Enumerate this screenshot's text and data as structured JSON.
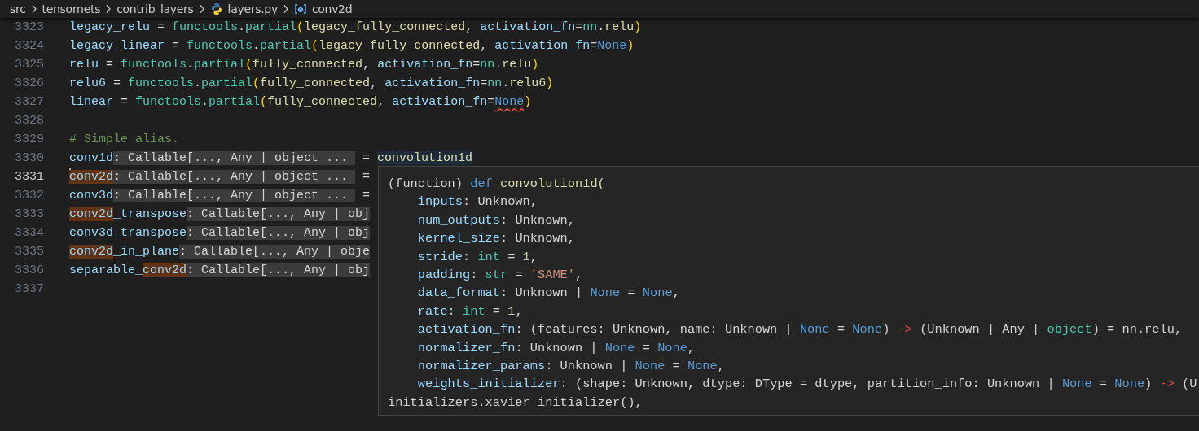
{
  "breadcrumb": [
    {
      "kind": "folder",
      "label": "src"
    },
    {
      "kind": "folder",
      "label": "tensornets"
    },
    {
      "kind": "folder",
      "label": "contrib_layers"
    },
    {
      "kind": "python-file",
      "label": "layers.py"
    },
    {
      "kind": "variable",
      "label": "conv2d"
    }
  ],
  "lines": [
    {
      "number": "3323",
      "current": false,
      "tokens": [
        {
          "kind": "var",
          "text": "legacy_relu"
        },
        {
          "kind": "plain",
          "text": " = "
        },
        {
          "kind": "module",
          "text": "functools"
        },
        {
          "kind": "plain",
          "text": "."
        },
        {
          "kind": "module",
          "text": "partial"
        },
        {
          "kind": "bracket",
          "text": "("
        },
        {
          "kind": "fn",
          "text": "legacy_fully_connected"
        },
        {
          "kind": "plain",
          "text": ", "
        },
        {
          "kind": "var",
          "text": "activation_fn"
        },
        {
          "kind": "plain",
          "text": "="
        },
        {
          "kind": "module",
          "text": "nn"
        },
        {
          "kind": "plain",
          "text": "."
        },
        {
          "kind": "fn",
          "text": "relu"
        },
        {
          "kind": "bracket",
          "text": ")"
        }
      ]
    },
    {
      "number": "3324",
      "current": false,
      "tokens": [
        {
          "kind": "var",
          "text": "legacy_linear"
        },
        {
          "kind": "plain",
          "text": " = "
        },
        {
          "kind": "module",
          "text": "functools"
        },
        {
          "kind": "plain",
          "text": "."
        },
        {
          "kind": "module",
          "text": "partial"
        },
        {
          "kind": "bracket",
          "text": "("
        },
        {
          "kind": "fn",
          "text": "legacy_fully_connected"
        },
        {
          "kind": "plain",
          "text": ", "
        },
        {
          "kind": "var",
          "text": "activation_fn"
        },
        {
          "kind": "plain",
          "text": "="
        },
        {
          "kind": "const",
          "text": "None"
        },
        {
          "kind": "bracket",
          "text": ")"
        }
      ]
    },
    {
      "number": "3325",
      "current": false,
      "tokens": [
        {
          "kind": "var",
          "text": "relu"
        },
        {
          "kind": "plain",
          "text": " = "
        },
        {
          "kind": "module",
          "text": "functools"
        },
        {
          "kind": "plain",
          "text": "."
        },
        {
          "kind": "module",
          "text": "partial"
        },
        {
          "kind": "bracket",
          "text": "("
        },
        {
          "kind": "fn",
          "text": "fully_connected"
        },
        {
          "kind": "plain",
          "text": ", "
        },
        {
          "kind": "var",
          "text": "activation_fn"
        },
        {
          "kind": "plain",
          "text": "="
        },
        {
          "kind": "module",
          "text": "nn"
        },
        {
          "kind": "plain",
          "text": "."
        },
        {
          "kind": "fn",
          "text": "relu"
        },
        {
          "kind": "bracket",
          "text": ")"
        }
      ]
    },
    {
      "number": "3326",
      "current": false,
      "tokens": [
        {
          "kind": "var",
          "text": "relu6"
        },
        {
          "kind": "plain",
          "text": " = "
        },
        {
          "kind": "module",
          "text": "functools"
        },
        {
          "kind": "plain",
          "text": "."
        },
        {
          "kind": "module",
          "text": "partial"
        },
        {
          "kind": "bracket",
          "text": "("
        },
        {
          "kind": "fn",
          "text": "fully_connected"
        },
        {
          "kind": "plain",
          "text": ", "
        },
        {
          "kind": "var",
          "text": "activation_fn"
        },
        {
          "kind": "plain",
          "text": "="
        },
        {
          "kind": "module",
          "text": "nn"
        },
        {
          "kind": "plain",
          "text": "."
        },
        {
          "kind": "fn",
          "text": "relu6"
        },
        {
          "kind": "bracket",
          "text": ")"
        }
      ]
    },
    {
      "number": "3327",
      "current": false,
      "tokens": [
        {
          "kind": "var",
          "text": "linear"
        },
        {
          "kind": "plain",
          "text": " = "
        },
        {
          "kind": "module",
          "text": "functools"
        },
        {
          "kind": "plain",
          "text": "."
        },
        {
          "kind": "module",
          "text": "partial"
        },
        {
          "kind": "bracket",
          "text": "("
        },
        {
          "kind": "fn",
          "text": "fully_connected"
        },
        {
          "kind": "plain",
          "text": ", "
        },
        {
          "kind": "var",
          "text": "activation_fn"
        },
        {
          "kind": "plain",
          "text": "="
        },
        {
          "kind": "error",
          "text": "None"
        },
        {
          "kind": "bracket",
          "text": ")"
        }
      ]
    },
    {
      "number": "3328",
      "current": false
    },
    {
      "number": "3329",
      "current": false,
      "tokens": [
        {
          "kind": "comment",
          "text": "# Simple alias."
        }
      ]
    },
    {
      "number": "3330",
      "current": false,
      "tokens": [
        {
          "kind": "var",
          "text": "conv1d"
        },
        {
          "kind": "hint",
          "text": ": Callable[..., Any | object ... "
        },
        {
          "kind": "plain",
          "text": " = "
        },
        {
          "kind": "hovered",
          "text": "convolution1d"
        }
      ]
    },
    {
      "number": "3331",
      "current": true,
      "tokens": [
        {
          "kind": "highlight",
          "text": "conv2d"
        },
        {
          "kind": "hint",
          "text": ": Callable[..., Any | object ... "
        },
        {
          "kind": "plain",
          "text": " ="
        }
      ]
    },
    {
      "number": "3332",
      "current": false,
      "tokens": [
        {
          "kind": "var",
          "text": "conv3d"
        },
        {
          "kind": "hint",
          "text": ": Callable[..., Any | object ... "
        },
        {
          "kind": "plain",
          "text": " ="
        }
      ]
    },
    {
      "number": "3333",
      "current": false,
      "tokens": [
        {
          "kind": "highlight",
          "text": "conv2d"
        },
        {
          "kind": "var",
          "text": "_transpose"
        },
        {
          "kind": "hint",
          "text": ": Callable[..., Any | obj"
        }
      ]
    },
    {
      "number": "3334",
      "current": false,
      "tokens": [
        {
          "kind": "var",
          "text": "conv3d_transpose"
        },
        {
          "kind": "hint",
          "text": ": Callable[..., Any | obj"
        }
      ]
    },
    {
      "number": "3335",
      "current": false,
      "tokens": [
        {
          "kind": "highlight",
          "text": "conv2d"
        },
        {
          "kind": "var",
          "text": "_in_plane"
        },
        {
          "kind": "hint",
          "text": ": Callable[..., Any | obje"
        }
      ]
    },
    {
      "number": "3336",
      "current": false,
      "tokens": [
        {
          "kind": "var",
          "text": "separable_"
        },
        {
          "kind": "highlight",
          "text": "conv2d"
        },
        {
          "kind": "hint",
          "text": ": Callable[..., Any | obj"
        }
      ]
    },
    {
      "number": "3337",
      "current": false
    }
  ],
  "hover": {
    "lines": [
      [
        {
          "kind": "plain",
          "text": "(function) "
        },
        {
          "kind": "keyword",
          "text": "def"
        },
        {
          "kind": "fn",
          "text": " convolution1d("
        }
      ],
      [
        {
          "kind": "param",
          "text": "    inputs"
        },
        {
          "kind": "plain",
          "text": ": Unknown,"
        }
      ],
      [
        {
          "kind": "param",
          "text": "    num_outputs"
        },
        {
          "kind": "plain",
          "text": ": Unknown,"
        }
      ],
      [
        {
          "kind": "param",
          "text": "    kernel_size"
        },
        {
          "kind": "plain",
          "text": ": Unknown,"
        }
      ],
      [
        {
          "kind": "param",
          "text": "    stride"
        },
        {
          "kind": "plain",
          "text": ": "
        },
        {
          "kind": "type",
          "text": "int"
        },
        {
          "kind": "plain",
          "text": " = "
        },
        {
          "kind": "number",
          "text": "1"
        },
        {
          "kind": "plain",
          "text": ","
        }
      ],
      [
        {
          "kind": "param",
          "text": "    padding"
        },
        {
          "kind": "plain",
          "text": ": "
        },
        {
          "kind": "type",
          "text": "str"
        },
        {
          "kind": "plain",
          "text": " = "
        },
        {
          "kind": "string",
          "text": "'SAME'"
        },
        {
          "kind": "plain",
          "text": ","
        }
      ],
      [
        {
          "kind": "param",
          "text": "    data_format"
        },
        {
          "kind": "plain",
          "text": ": Unknown | "
        },
        {
          "kind": "keyword",
          "text": "None"
        },
        {
          "kind": "plain",
          "text": " = "
        },
        {
          "kind": "keyword",
          "text": "None"
        },
        {
          "kind": "plain",
          "text": ","
        }
      ],
      [
        {
          "kind": "param",
          "text": "    rate"
        },
        {
          "kind": "plain",
          "text": ": "
        },
        {
          "kind": "type",
          "text": "int"
        },
        {
          "kind": "plain",
          "text": " = "
        },
        {
          "kind": "number",
          "text": "1"
        },
        {
          "kind": "plain",
          "text": ","
        }
      ],
      [
        {
          "kind": "param",
          "text": "    activation_fn"
        },
        {
          "kind": "plain",
          "text": ": (features: Unknown, name: Unknown | "
        },
        {
          "kind": "keyword",
          "text": "None"
        },
        {
          "kind": "plain",
          "text": " = "
        },
        {
          "kind": "keyword",
          "text": "None"
        },
        {
          "kind": "plain",
          "text": ") "
        },
        {
          "kind": "arrow",
          "text": "->"
        },
        {
          "kind": "plain",
          "text": " (Unknown | Any | "
        },
        {
          "kind": "type",
          "text": "object"
        },
        {
          "kind": "plain",
          "text": ") = nn.relu,"
        }
      ],
      [
        {
          "kind": "param",
          "text": "    normalizer_fn"
        },
        {
          "kind": "plain",
          "text": ": Unknown | "
        },
        {
          "kind": "keyword",
          "text": "None"
        },
        {
          "kind": "plain",
          "text": " = "
        },
        {
          "kind": "keyword",
          "text": "None"
        },
        {
          "kind": "plain",
          "text": ","
        }
      ],
      [
        {
          "kind": "param",
          "text": "    normalizer_params"
        },
        {
          "kind": "plain",
          "text": ": Unknown | "
        },
        {
          "kind": "keyword",
          "text": "None"
        },
        {
          "kind": "plain",
          "text": " = "
        },
        {
          "kind": "keyword",
          "text": "None"
        },
        {
          "kind": "plain",
          "text": ","
        }
      ],
      [
        {
          "kind": "param",
          "text": "    weights_initializer"
        },
        {
          "kind": "plain",
          "text": ": (shape: Unknown, dtype: DType = dtype, partition_info: Unknown | "
        },
        {
          "kind": "keyword",
          "text": "None"
        },
        {
          "kind": "plain",
          "text": " = "
        },
        {
          "kind": "keyword",
          "text": "None"
        },
        {
          "kind": "plain",
          "text": ") "
        },
        {
          "kind": "arrow",
          "text": "->"
        },
        {
          "kind": "plain",
          "text": " (U"
        }
      ],
      [
        {
          "kind": "plain",
          "text": "initializers.xavier_initializer(),"
        }
      ]
    ]
  }
}
